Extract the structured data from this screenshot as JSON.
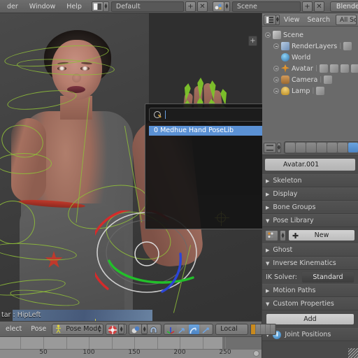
{
  "topbar": {
    "menus": [
      "der",
      "Window",
      "Help"
    ],
    "layout_icon": "screen-layout-icon",
    "screen_value": "Default",
    "add_screen_label": "+",
    "delete_screen_label": "✕",
    "scene_icon": "scene-icon",
    "scene_value": "Scene",
    "add_scene_label": "+",
    "delete_scene_label": "✕",
    "engine_value": "Blender Render"
  },
  "viewport": {
    "status_text": "tar : HipLeft",
    "panel_toggle_label": "+",
    "gizmo_name": "rotation-manipulator",
    "gizmo_colors": {
      "x": "#d42b2b",
      "y": "#22c02a",
      "z": "#2b45d8",
      "view": "#dcdcdc"
    },
    "armature_color": "#8fbe3a",
    "bone_selected_color": "#7ec52a",
    "cursor_color": "#cfcf4a"
  },
  "popup": {
    "search_icon": "search-icon",
    "search_value": "",
    "results": [
      {
        "label": "0 Medhue Hand PoseLib",
        "selected": true
      }
    ]
  },
  "outliner": {
    "header": {
      "editor_icon": "outliner-icon",
      "menus": [
        "View",
        "Search"
      ],
      "display_mode": "All Scene"
    },
    "rows": [
      {
        "indent": 0,
        "icon": "scene-icon",
        "label": "Scene",
        "extras": []
      },
      {
        "indent": 1,
        "icon": "renderlayers-icon",
        "label": "RenderLayers",
        "extras": [
          "renderlayer-data-icon"
        ]
      },
      {
        "indent": 1,
        "icon": "world-icon",
        "label": "World",
        "extras": []
      },
      {
        "indent": 1,
        "icon": "armature-icon",
        "label": "Avatar",
        "extras": [
          "modifier-icon",
          "pose-icon",
          "bone-icon",
          "bone-data-icon"
        ]
      },
      {
        "indent": 1,
        "icon": "camera-icon",
        "label": "Camera",
        "extras": [
          "camera-data-icon"
        ]
      },
      {
        "indent": 1,
        "icon": "lamp-icon",
        "label": "Lamp",
        "extras": [
          "lamp-data-icon"
        ]
      }
    ]
  },
  "properties": {
    "header": {
      "editor_icon": "properties-icon",
      "tabs": [
        {
          "name": "render-tab",
          "active": false
        },
        {
          "name": "renderlayers-tab",
          "active": false
        },
        {
          "name": "scene-tab",
          "active": false
        },
        {
          "name": "world-tab",
          "active": false
        },
        {
          "name": "object-tab",
          "active": false
        },
        {
          "name": "constraints-tab",
          "active": false
        },
        {
          "name": "armature-tab",
          "active": true
        }
      ]
    },
    "datablock": {
      "icon": "armature-data-icon",
      "value": "Avatar.001"
    },
    "panels": [
      {
        "label": "Skeleton",
        "open": false
      },
      {
        "label": "Display",
        "open": false
      },
      {
        "label": "Bone Groups",
        "open": false
      },
      {
        "label": "Pose Library",
        "open": true
      }
    ],
    "pose_library": {
      "browse_icon": "browse-pose-icon",
      "new_label": "New",
      "new_icon": "plus-icon"
    },
    "panels2": [
      {
        "label": "Ghost",
        "open": false
      },
      {
        "label": "Inverse Kinematics",
        "open": true
      }
    ],
    "ik": {
      "label": "IK Solver:",
      "value": "Standard"
    },
    "panels3": [
      {
        "label": "Motion Paths",
        "open": false
      },
      {
        "label": "Custom Properties",
        "open": true
      }
    ],
    "custom_props": {
      "add_label": "Add"
    },
    "joint_positions": {
      "label": "Joint Positions",
      "icon": "info-icon",
      "open": false
    }
  },
  "bottombar": {
    "menus": [
      "elect",
      "Pose"
    ],
    "mode": {
      "icon": "pose-mode-icon",
      "value": "Pose Mode"
    },
    "pivot_icon": "pivot-icon",
    "snap_icon": "snap-magnet-icon",
    "snap_element_icon": "snap-element-icon",
    "manipulator_icon": "manipulator-toggle-icon",
    "manipulators": [
      {
        "name": "translate-manipulator",
        "active": false
      },
      {
        "name": "rotate-manipulator",
        "active": true
      },
      {
        "name": "scale-manipulator",
        "active": false
      }
    ],
    "orientation": "Local",
    "layers_active_index": 0
  },
  "timeline": {
    "ticks": [
      "50",
      "100",
      "150",
      "200",
      "250"
    ],
    "tick_positions": [
      62,
      127,
      192,
      257,
      322
    ]
  }
}
